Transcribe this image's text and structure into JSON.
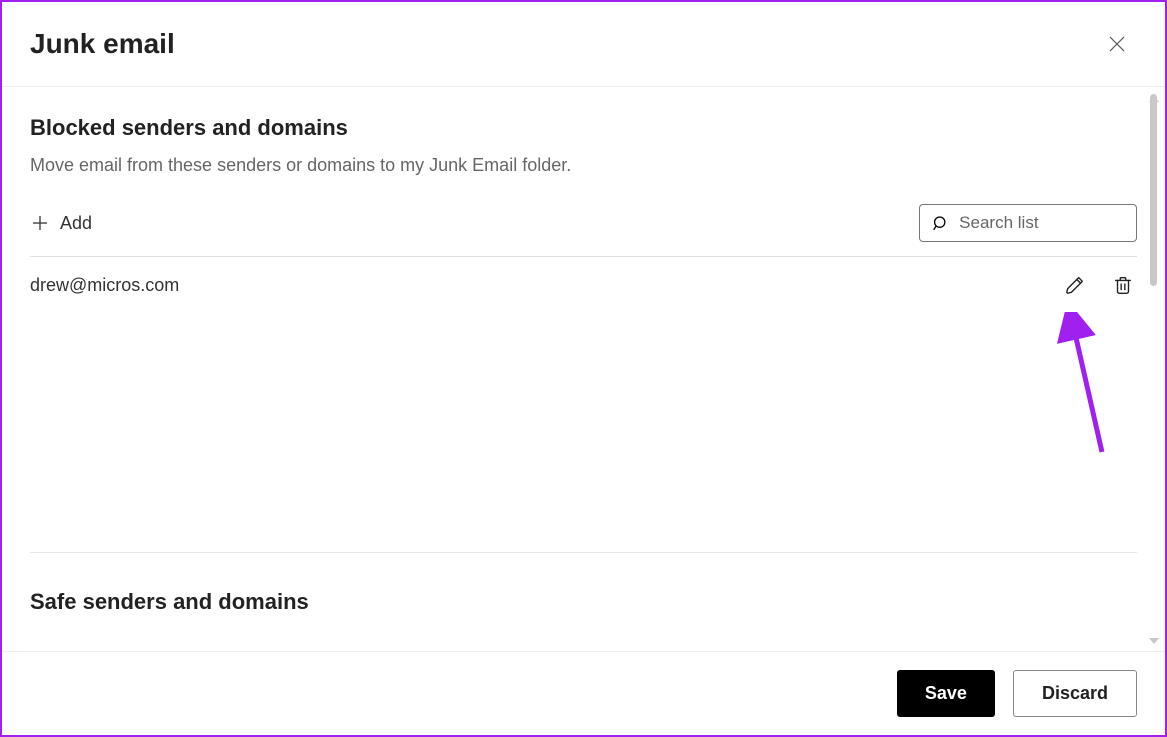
{
  "header": {
    "title": "Junk email"
  },
  "blocked": {
    "title": "Blocked senders and domains",
    "desc": "Move email from these senders or domains to my Junk Email folder.",
    "add_label": "Add",
    "search_placeholder": "Search list",
    "items": [
      {
        "email": "drew@micros.com"
      }
    ]
  },
  "safe": {
    "title": "Safe senders and domains"
  },
  "footer": {
    "save_label": "Save",
    "discard_label": "Discard"
  }
}
